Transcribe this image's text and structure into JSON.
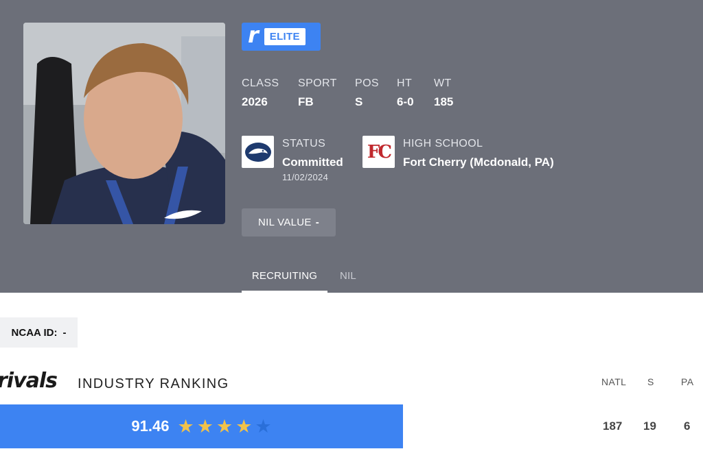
{
  "badge": {
    "brand_letter": "r",
    "tier": "ELITE"
  },
  "attributes": [
    {
      "label": "CLASS",
      "value": "2026"
    },
    {
      "label": "SPORT",
      "value": "FB"
    },
    {
      "label": "POS",
      "value": "S"
    },
    {
      "label": "HT",
      "value": "6-0"
    },
    {
      "label": "WT",
      "value": "185"
    }
  ],
  "status": {
    "label": "STATUS",
    "value": "Committed",
    "date": "11/02/2024",
    "logo_icon": "penn-state-logo-icon"
  },
  "high_school": {
    "label": "HIGH SCHOOL",
    "value": "Fort Cherry (Mcdonald, PA)",
    "logo_text": "FC",
    "logo_icon": "fort-cherry-logo-icon"
  },
  "nil_button": {
    "label": "NIL VALUE",
    "value": "-"
  },
  "tabs": [
    {
      "label": "RECRUITING",
      "active": true
    },
    {
      "label": "NIL",
      "active": false
    }
  ],
  "ncaa": {
    "label": "NCAA ID:",
    "value": "-"
  },
  "ranking": {
    "brand": "rivals",
    "title": "INDUSTRY RANKING",
    "score": "91.46",
    "stars_filled": 4,
    "stars_total": 5,
    "columns": [
      "NATL",
      "S",
      "PA"
    ],
    "values": [
      "187",
      "19",
      "6"
    ]
  },
  "colors": {
    "hero_bg": "#6c6f79",
    "accent_blue": "#3d83f2",
    "star_gold": "#f1c24a"
  }
}
